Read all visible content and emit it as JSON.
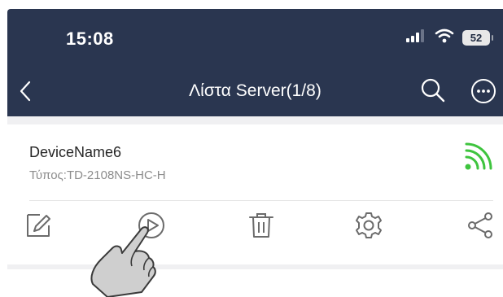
{
  "status_bar": {
    "time": "15:08",
    "battery": "52",
    "icons": [
      "signal-bars-icon",
      "wifi-status-icon",
      "battery-icon"
    ]
  },
  "nav": {
    "title": "Λίστα Server(1/8)",
    "left_icon": "back-chevron-icon",
    "right_icons": [
      "search-icon",
      "more-options-icon"
    ]
  },
  "device": {
    "name": "DeviceName6",
    "type": "Τύπος:TD-2108NS-HC-H",
    "status_icon": "wifi-online-icon",
    "actions": [
      "edit-icon",
      "play-icon",
      "delete-icon",
      "settings-icon",
      "share-icon"
    ]
  },
  "colors": {
    "header_bg": "#2a3650",
    "accent_online": "#3ec43e",
    "icon_gray": "#6b6b6b"
  }
}
